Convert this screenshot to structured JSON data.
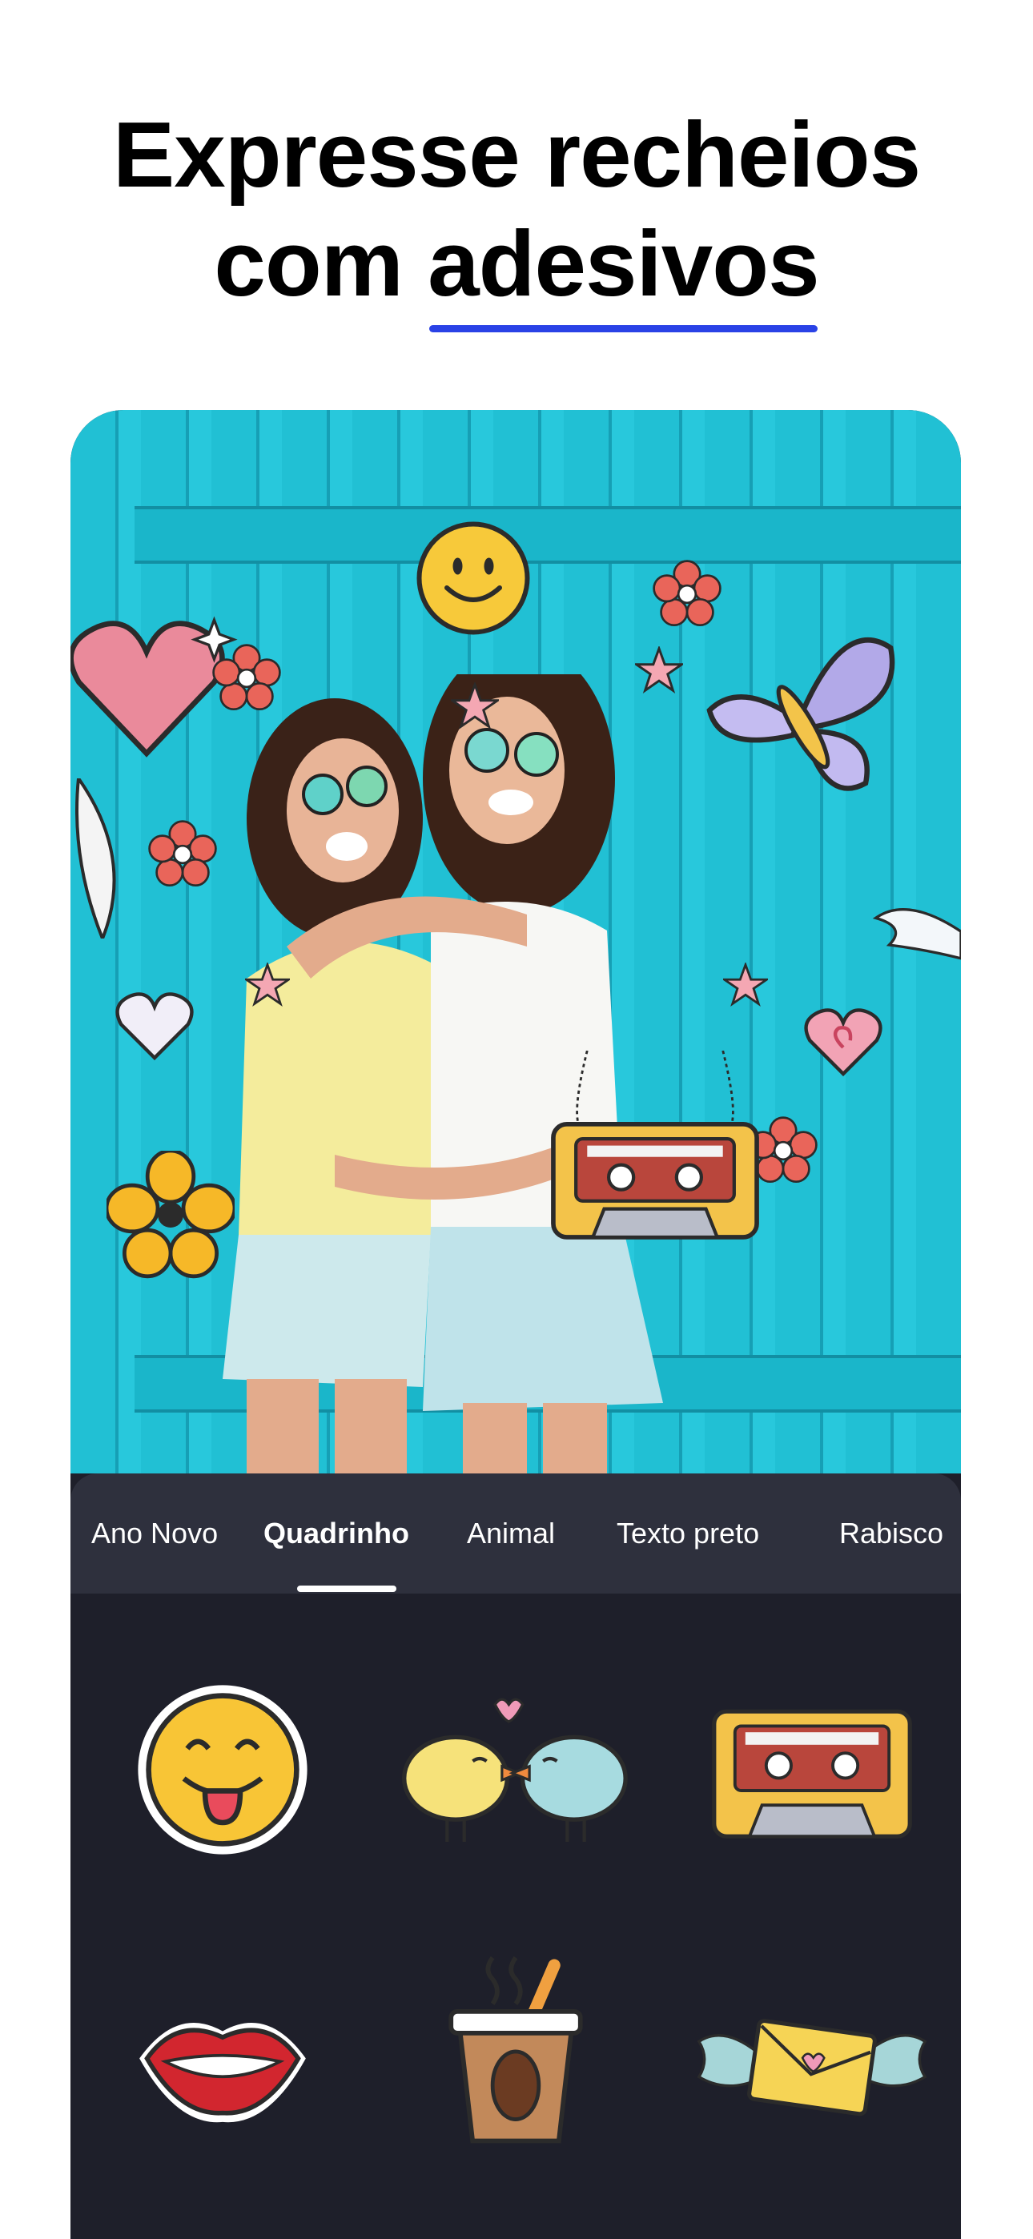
{
  "headline": {
    "line1": "Expresse recheios",
    "line2_prefix": "com ",
    "line2_highlight": "adesivos"
  },
  "colors": {
    "accent_underline": "#2a42e6",
    "panel_background": "#1e1f2a",
    "tab_bar_background": "#2e303d",
    "wall": "#21c0d4"
  },
  "categories": {
    "tabs": [
      "Ano Novo",
      "Quadrinho",
      "Animal",
      "Texto preto",
      "Rabisco"
    ],
    "active_index": 1
  },
  "stickers": [
    {
      "name": "tongue-emoji-sticker"
    },
    {
      "name": "kissing-birds-sticker"
    },
    {
      "name": "cassette-tape-sticker"
    },
    {
      "name": "lips-sticker"
    },
    {
      "name": "coffee-cup-sticker"
    },
    {
      "name": "winged-envelope-sticker"
    }
  ]
}
